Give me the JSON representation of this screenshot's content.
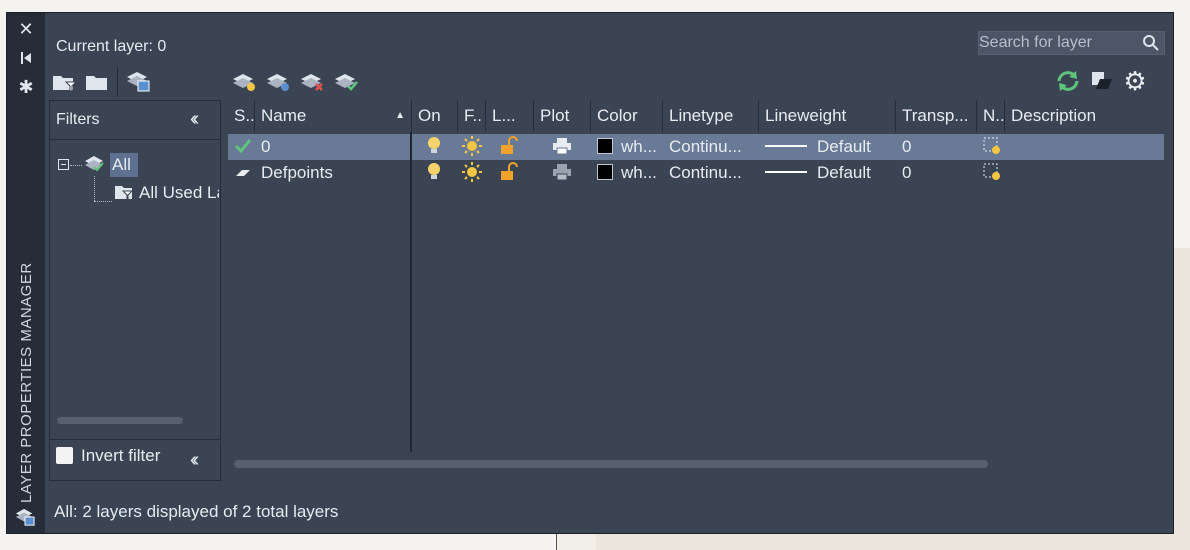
{
  "panel": {
    "vertical_title": "LAYER PROPERTIES MANAGER",
    "current_layer_label": "Current layer: 0",
    "search_placeholder": "Search for layer",
    "status_text": "All: 2 layers displayed of 2 total layers"
  },
  "filters": {
    "header": "Filters",
    "tree": [
      {
        "label": "All",
        "selected": true
      },
      {
        "label": "All Used Layers"
      }
    ],
    "invert_filter_label": "Invert filter",
    "invert_filter_checked": false
  },
  "columns": [
    "S..",
    "Name",
    "On",
    "F..",
    "L...",
    "Plot",
    "Color",
    "Linetype",
    "Lineweight",
    "Transp...",
    "N..",
    "Description"
  ],
  "layers": [
    {
      "current": true,
      "name": "0",
      "color": "wh...",
      "linetype": "Continu...",
      "lineweight": "Default",
      "transparency": "0",
      "description": ""
    },
    {
      "current": false,
      "name": "Defpoints",
      "color": "wh...",
      "linetype": "Continu...",
      "lineweight": "Default",
      "transparency": "0",
      "description": ""
    }
  ],
  "colors": {
    "panel_bg": "#3b4453",
    "frame_bg": "#262d39",
    "selected_row": "#687a96",
    "current_check": "#5ec47b",
    "bulb": "#f7d36b",
    "sun": "#f3c543",
    "lock": "#f0a22a"
  },
  "icons": [
    "close-icon",
    "pin-icon",
    "settings-icon",
    "new-filter-icon",
    "group-filter-icon",
    "layer-states-icon",
    "new-layer-icon",
    "new-vp-frozen-layer-icon",
    "delete-layer-icon",
    "set-current-icon",
    "refresh-icon",
    "layer-settings-icon",
    "search-icon"
  ]
}
